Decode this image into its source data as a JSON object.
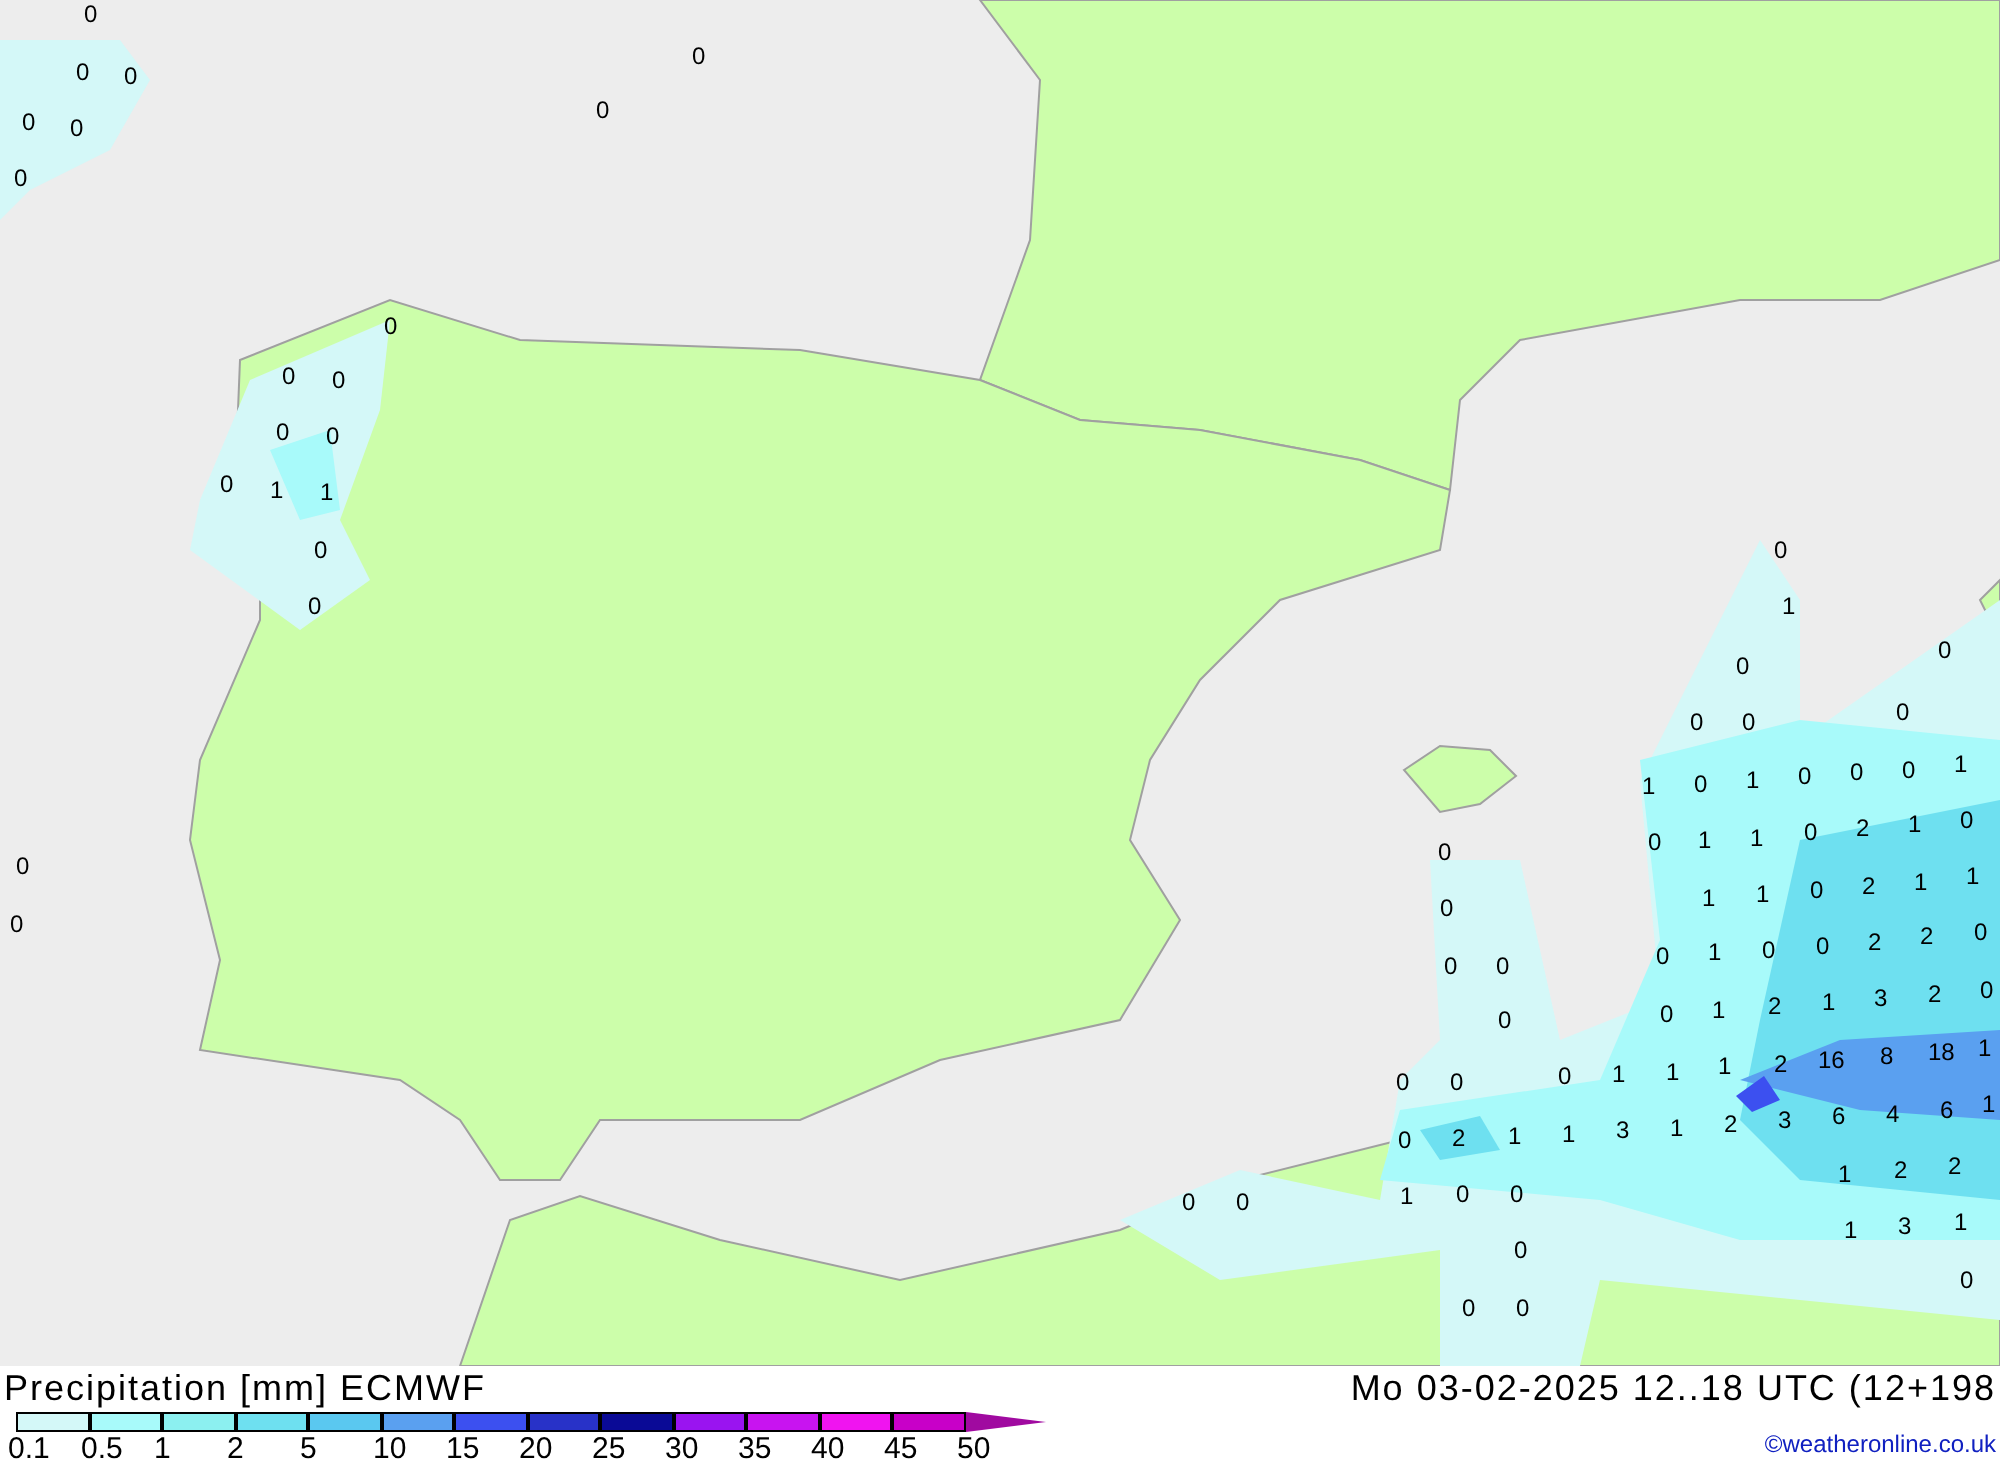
{
  "map": {
    "values": [
      "0",
      "0",
      "0",
      "0",
      "0",
      "0",
      "0",
      "0",
      "0",
      "0",
      "0",
      "0",
      "0",
      "0",
      "1",
      "1",
      "0",
      "0",
      "0",
      "0",
      "0",
      "1",
      "0",
      "0",
      "0",
      "0",
      "0",
      "1",
      "0",
      "1",
      "0",
      "0",
      "0",
      "1",
      "0",
      "1",
      "1",
      "0",
      "2",
      "1",
      "0",
      "1",
      "1",
      "0",
      "2",
      "1",
      "1",
      "0",
      "1",
      "0",
      "0",
      "2",
      "2",
      "0",
      "0",
      "1",
      "2",
      "1",
      "3",
      "2",
      "0",
      "0",
      "1",
      "1",
      "1",
      "2",
      "16",
      "8",
      "18",
      "1",
      "1",
      "2",
      "3",
      "6",
      "4",
      "6",
      "1",
      "0",
      "0",
      "0",
      "2",
      "1",
      "1",
      "3",
      "1",
      "2",
      "2",
      "1",
      "0",
      "0",
      "0",
      "0",
      "1",
      "3",
      "1",
      "0",
      "0",
      "0",
      "0",
      "0",
      "0",
      "0",
      "0",
      "0"
    ]
  },
  "legend": {
    "title": "Precipitation [mm] ECMWF",
    "date": "Mo 03-02-2025 12..18 UTC (12+198",
    "credit": "©weatheronline.co.uk",
    "items": [
      {
        "label": "0.1",
        "color": "#d4f8f8"
      },
      {
        "label": "0.5",
        "color": "#a8fafa"
      },
      {
        "label": "1",
        "color": "#8cf0f0"
      },
      {
        "label": "2",
        "color": "#6ee0f0"
      },
      {
        "label": "5",
        "color": "#5ac8f0"
      },
      {
        "label": "10",
        "color": "#5aa0f0"
      },
      {
        "label": "15",
        "color": "#3c50f0"
      },
      {
        "label": "20",
        "color": "#2832c8"
      },
      {
        "label": "25",
        "color": "#0a0a96"
      },
      {
        "label": "30",
        "color": "#9a14f0"
      },
      {
        "label": "35",
        "color": "#c814f0"
      },
      {
        "label": "40",
        "color": "#f014f0"
      },
      {
        "label": "45",
        "color": "#c800c8"
      },
      {
        "label": "50",
        "color": "#a00aa0"
      }
    ]
  }
}
